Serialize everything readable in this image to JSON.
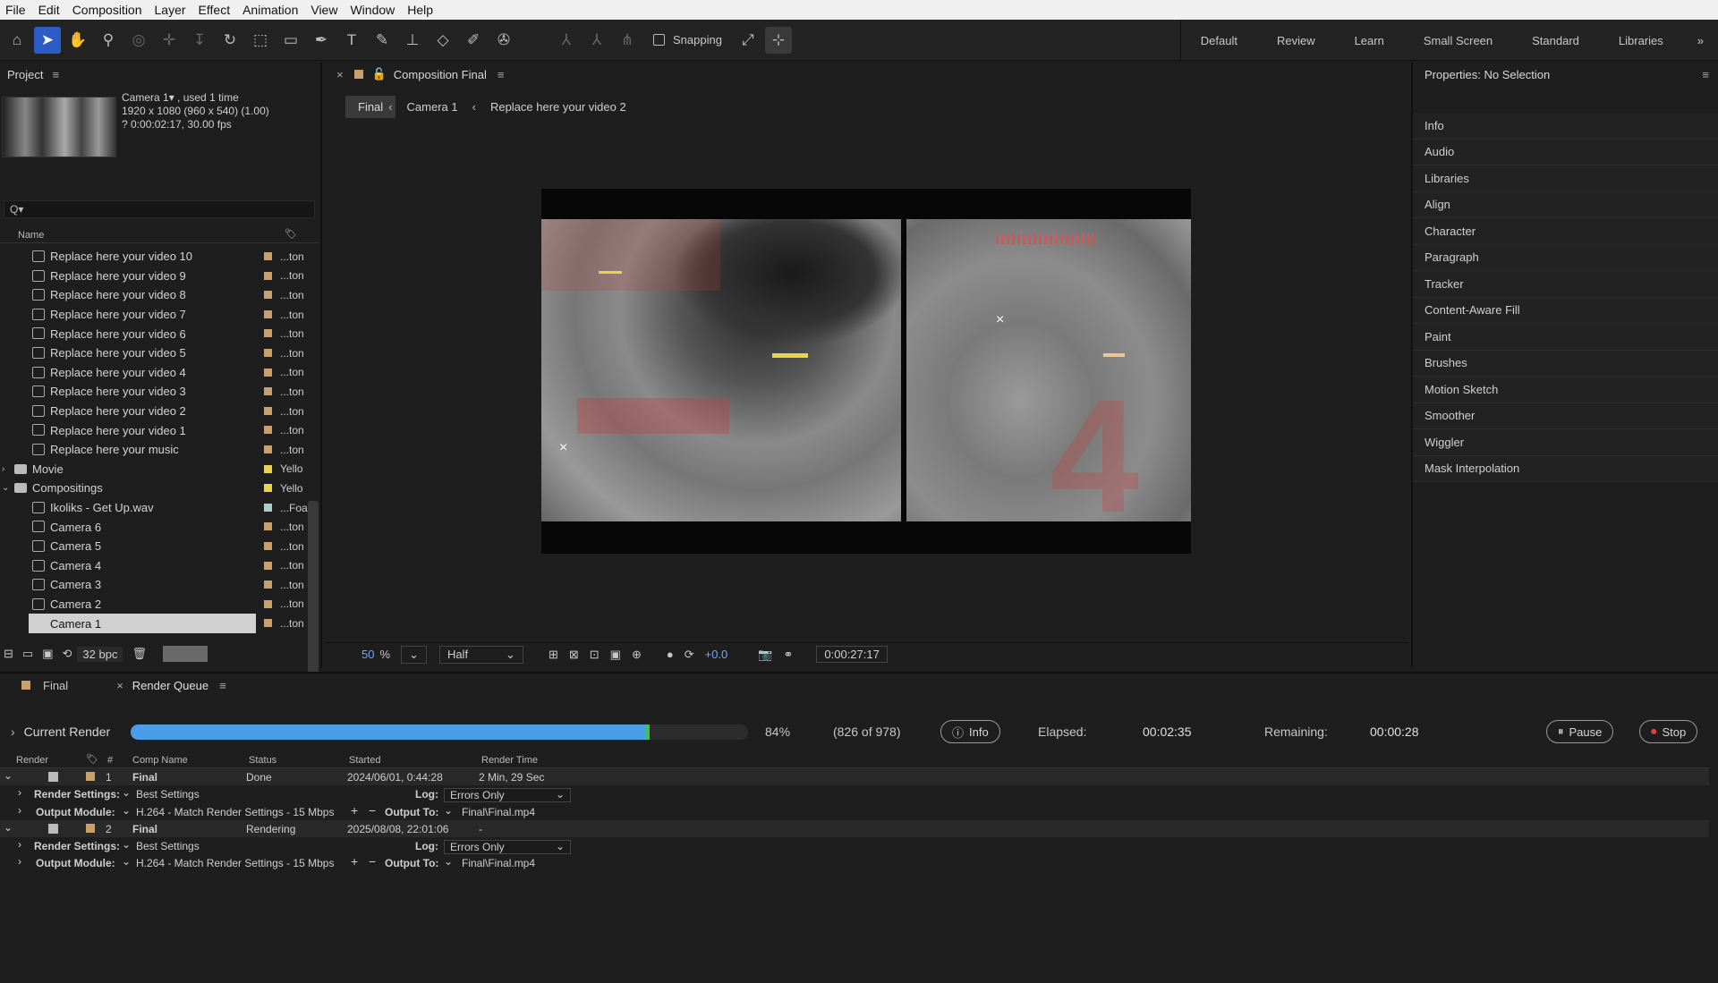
{
  "menu": [
    "File",
    "Edit",
    "Composition",
    "Layer",
    "Effect",
    "Animation",
    "View",
    "Window",
    "Help"
  ],
  "toolbar": {
    "snapping": "Snapping"
  },
  "workspaces": [
    "Default",
    "Review",
    "Learn",
    "Small Screen",
    "Standard",
    "Libraries"
  ],
  "project": {
    "title": "Project",
    "info": {
      "name": "Camera 1▾ , used 1 time",
      "size": "1920 x 1080  (960 x 540) (1.00)",
      "duration": "? 0:00:02:17, 30.00 fps"
    },
    "search_placeholder": "Q▾",
    "col_name": "Name",
    "items": [
      {
        "name": "Replace here your video 10",
        "type": "...ton",
        "color": "#c9a06a",
        "kind": "comp"
      },
      {
        "name": "Replace here your video 9",
        "type": "...ton",
        "color": "#c9a06a",
        "kind": "comp"
      },
      {
        "name": "Replace here your video 8",
        "type": "...ton",
        "color": "#c9a06a",
        "kind": "comp"
      },
      {
        "name": "Replace here your video 7",
        "type": "...ton",
        "color": "#c9a06a",
        "kind": "comp"
      },
      {
        "name": "Replace here your video 6",
        "type": "...ton",
        "color": "#c9a06a",
        "kind": "comp"
      },
      {
        "name": "Replace here your video 5",
        "type": "...ton",
        "color": "#c9a06a",
        "kind": "comp"
      },
      {
        "name": "Replace here your video 4",
        "type": "...ton",
        "color": "#c9a06a",
        "kind": "comp"
      },
      {
        "name": "Replace here your video 3",
        "type": "...ton",
        "color": "#c9a06a",
        "kind": "comp"
      },
      {
        "name": "Replace here your video 2",
        "type": "...ton",
        "color": "#c9a06a",
        "kind": "comp"
      },
      {
        "name": "Replace here your video 1",
        "type": "...ton",
        "color": "#c9a06a",
        "kind": "comp"
      },
      {
        "name": "Replace here your music",
        "type": "...ton",
        "color": "#c9a06a",
        "kind": "comp"
      },
      {
        "name": "Movie",
        "type": "Yello",
        "color": "#e8d44a",
        "kind": "folder"
      },
      {
        "name": "Compositings",
        "type": "Yello",
        "color": "#e8d44a",
        "kind": "folder"
      },
      {
        "name": "Ikoliks - Get Up.wav",
        "type": "...Foa",
        "color": "#a8d0c8",
        "kind": "file"
      },
      {
        "name": "Camera 6",
        "type": "...ton",
        "color": "#c9a06a",
        "kind": "comp"
      },
      {
        "name": "Camera 5",
        "type": "...ton",
        "color": "#c9a06a",
        "kind": "comp"
      },
      {
        "name": "Camera 4",
        "type": "...ton",
        "color": "#c9a06a",
        "kind": "comp"
      },
      {
        "name": "Camera 3",
        "type": "...ton",
        "color": "#c9a06a",
        "kind": "comp"
      },
      {
        "name": "Camera 2",
        "type": "...ton",
        "color": "#c9a06a",
        "kind": "comp"
      },
      {
        "name": "Camera 1",
        "type": "...ton",
        "color": "#c9a06a",
        "kind": "comp",
        "selected": true
      }
    ],
    "bpc": "32 bpc"
  },
  "composition": {
    "title": "Composition Final",
    "crumbs": [
      "Final",
      "Camera 1",
      "Replace here your video 2"
    ],
    "zoom": "50",
    "zoom_unit": "%",
    "resolution": "Half",
    "exposure": "+0.0",
    "timecode": "0:00:27:17"
  },
  "properties": {
    "title": "Properties: No Selection",
    "items": [
      "Info",
      "Audio",
      "Libraries",
      "Align",
      "Character",
      "Paragraph",
      "Tracker",
      "Content-Aware Fill",
      "Paint",
      "Brushes",
      "Motion Sketch",
      "Smoother",
      "Wiggler",
      "Mask Interpolation"
    ]
  },
  "render_queue": {
    "tabs": [
      "Final",
      "Render Queue"
    ],
    "current_label": "Current Render",
    "progress": 0.84,
    "percent": "84%",
    "frames": "(826 of 978)",
    "info_btn": "Info",
    "elapsed_label": "Elapsed:",
    "elapsed": "00:02:35",
    "remaining_label": "Remaining:",
    "remaining": "00:00:28",
    "pause": "Pause",
    "stop": "Stop",
    "headers": [
      "Render",
      "#",
      "Comp Name",
      "Status",
      "Started",
      "Render Time"
    ],
    "rs_label": "Render Settings:",
    "om_label": "Output Module:",
    "log_label": "Log:",
    "out_label": "Output To:",
    "items": [
      {
        "num": "1",
        "comp": "Final",
        "status": "Done",
        "started": "2024/06/01, 0:44:28",
        "time": "2 Min, 29 Sec",
        "rs": "Best Settings",
        "log": "Errors Only",
        "om": "H.264 - Match Render Settings - 15 Mbps",
        "out": "Final\\Final.mp4"
      },
      {
        "num": "2",
        "comp": "Final",
        "status": "Rendering",
        "started": "2025/08/08, 22:01:06",
        "time": "-",
        "rs": "Best Settings",
        "log": "Errors Only",
        "om": "H.264 - Match Render Settings - 15 Mbps",
        "out": "Final\\Final.mp4"
      }
    ]
  }
}
